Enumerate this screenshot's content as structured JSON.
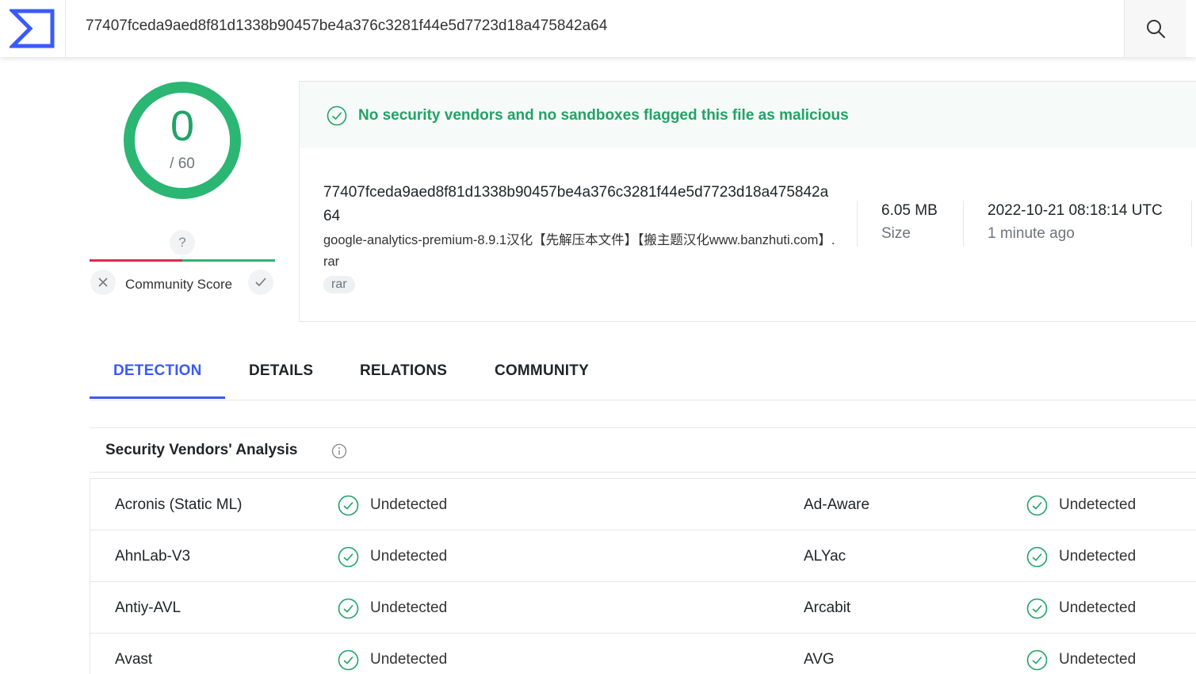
{
  "search": {
    "value": "77407fceda9aed8f81d1338b90457be4a376c3281f44e5d7723d18a475842a64"
  },
  "score": {
    "detections": "0",
    "total": "/ 60"
  },
  "community": {
    "unknown": "?",
    "label": "Community Score"
  },
  "banner": {
    "text": "No security vendors and no sandboxes flagged this file as malicious"
  },
  "file": {
    "hash": "77407fceda9aed8f81d1338b90457be4a376c3281f44e5d7723d18a475842a64",
    "name": "google-analytics-premium-8.9.1汉化【先解压本文件】【搬主题汉化www.banzhuti.com】.rar",
    "tag": "rar",
    "size_value": "6.05 MB",
    "size_label": "Size",
    "date_value": "2022-10-21 08:18:14 UTC",
    "date_label": "1 minute ago"
  },
  "tabs": [
    "DETECTION",
    "DETAILS",
    "RELATIONS",
    "COMMUNITY"
  ],
  "vendors": {
    "title": "Security Vendors' Analysis",
    "rows": [
      {
        "left_name": "Acronis (Static ML)",
        "left_status": "Undetected",
        "right_name": "Ad-Aware",
        "right_status": "Undetected"
      },
      {
        "left_name": "AhnLab-V3",
        "left_status": "Undetected",
        "right_name": "ALYac",
        "right_status": "Undetected"
      },
      {
        "left_name": "Antiy-AVL",
        "left_status": "Undetected",
        "right_name": "Arcabit",
        "right_status": "Undetected"
      },
      {
        "left_name": "Avast",
        "left_status": "Undetected",
        "right_name": "AVG",
        "right_status": "Undetected"
      }
    ]
  },
  "colors": {
    "accent": "#3a5af9",
    "clean": "#21a366",
    "malicious": "#e4264a"
  }
}
